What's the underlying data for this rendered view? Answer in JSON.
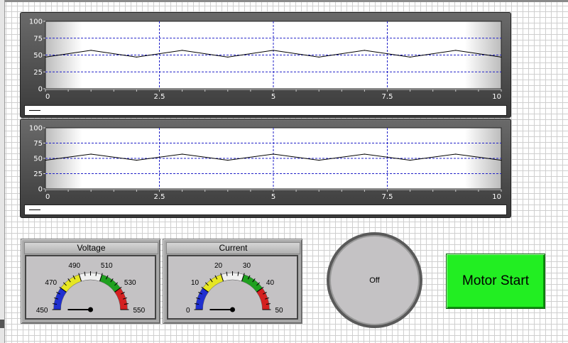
{
  "charts": [
    {
      "chart_data": {
        "type": "line",
        "x": [
          0,
          1,
          2,
          3,
          4,
          5,
          6,
          7,
          8,
          9,
          10
        ],
        "series": [
          {
            "values": [
              47,
              57,
              47,
              57,
              47,
              57,
              47,
              57,
              47,
              57,
              47
            ]
          }
        ],
        "xticks": [
          "0",
          "2.5",
          "5",
          "7.5",
          "10"
        ],
        "yticks": [
          "0",
          "25",
          "50",
          "75",
          "100"
        ],
        "xlim": [
          0,
          10
        ],
        "ylim": [
          0,
          100
        ],
        "grid": true
      }
    },
    {
      "chart_data": {
        "type": "line",
        "x": [
          0,
          1,
          2,
          3,
          4,
          5,
          6,
          7,
          8,
          9,
          10
        ],
        "series": [
          {
            "values": [
              47,
              57,
              47,
              57,
              47,
              57,
              47,
              57,
              47,
              57,
              47
            ]
          }
        ],
        "xticks": [
          "0",
          "2.5",
          "5",
          "7.5",
          "10"
        ],
        "yticks": [
          "0",
          "25",
          "50",
          "75",
          "100"
        ],
        "xlim": [
          0,
          10
        ],
        "ylim": [
          0,
          100
        ],
        "grid": true
      }
    }
  ],
  "gauges": {
    "voltage": {
      "title": "Voltage",
      "min": 450,
      "max": 550,
      "value": 450,
      "labels": [
        "450",
        "470",
        "490",
        "510",
        "530",
        "550"
      ]
    },
    "current": {
      "title": "Current",
      "min": 0,
      "max": 50,
      "value": 0,
      "labels": [
        "0",
        "10",
        "20",
        "30",
        "40",
        "50"
      ]
    },
    "band_colors": [
      "#1f2fcf",
      "#e6e622",
      "#f0f0f0",
      "#1fa01f",
      "#d42020"
    ]
  },
  "indicator": {
    "label": "Off",
    "color": "#c4c2c4"
  },
  "motor_button": {
    "label": "Motor Start",
    "color": "#22ee22"
  }
}
